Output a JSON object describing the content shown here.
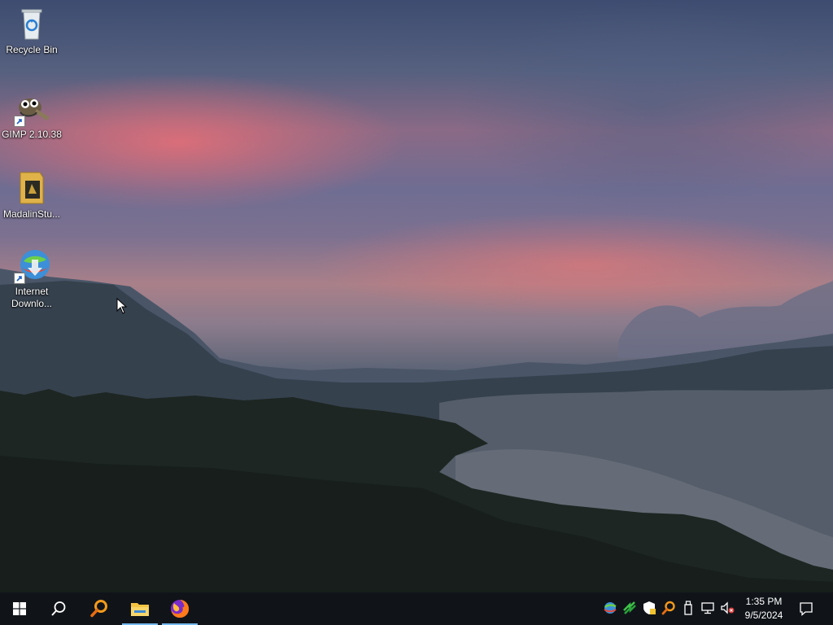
{
  "desktop": {
    "icons": [
      {
        "label": "Recycle Bin",
        "icon": "recycle-bin-icon",
        "shortcut": false
      },
      {
        "label": "GIMP 2.10.38",
        "icon": "gimp-icon",
        "shortcut": true
      },
      {
        "label": "MadalinStu...",
        "icon": "madalin-stunt-cars-icon",
        "shortcut": false
      },
      {
        "label": "Internet Downlo...",
        "icon": "internet-download-manager-icon",
        "shortcut": true
      }
    ]
  },
  "taskbar": {
    "start": "windows-start-icon",
    "search": "search-icon",
    "pinned": [
      {
        "name": "search-tool-app",
        "icon": "orange-magnifier-icon"
      },
      {
        "name": "file-explorer",
        "icon": "folder-icon",
        "active": true
      },
      {
        "name": "firefox",
        "icon": "firefox-icon",
        "active": true
      }
    ],
    "tray": [
      "idm-tray-icon",
      "network-activity-icon",
      "security-shield-icon",
      "orange-magnifier-icon",
      "usb-device-icon",
      "network-icon",
      "volume-muted-icon"
    ],
    "clock": {
      "time": "1:35 PM",
      "date": "9/5/2024"
    },
    "notifications": "action-center-icon"
  },
  "colors": {
    "taskbar": "#101419",
    "accent": "#76b9ed",
    "sky_pink": "#e86e76"
  }
}
